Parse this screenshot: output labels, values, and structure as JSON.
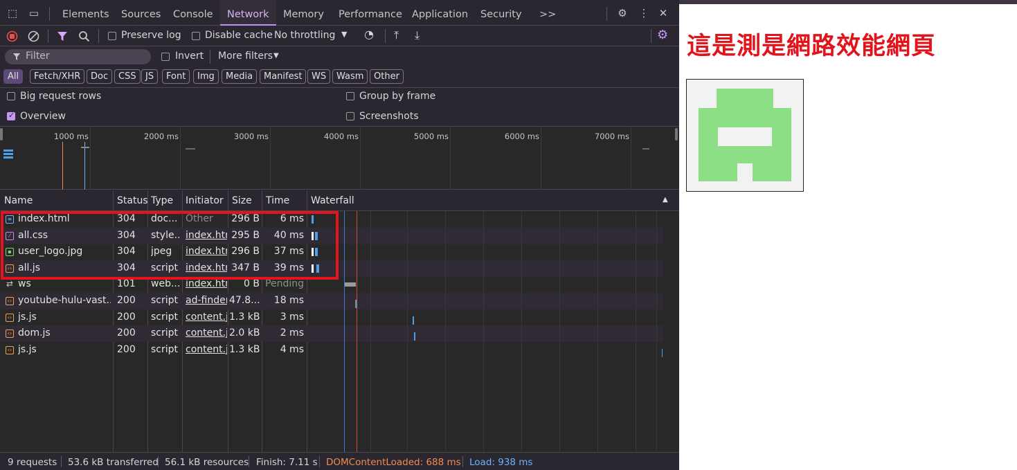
{
  "devtools": {
    "tabs": [
      "Elements",
      "Sources",
      "Console",
      "Network",
      "Memory",
      "Performance",
      "Application",
      "Security"
    ],
    "more_tabs": ">>",
    "toolbar": {
      "preserve_log": "Preserve log",
      "disable_cache": "Disable cache",
      "throttling": "No throttling"
    },
    "filter": {
      "placeholder": "Filter",
      "invert": "Invert",
      "more_filters": "More filters"
    },
    "type_chips": [
      "All",
      "Fetch/XHR",
      "Doc",
      "CSS",
      "JS",
      "Font",
      "Img",
      "Media",
      "Manifest",
      "WS",
      "Wasm",
      "Other"
    ],
    "options": {
      "big_request_rows": "Big request rows",
      "group_by_frame": "Group by frame",
      "overview": "Overview",
      "screenshots": "Screenshots"
    },
    "overview_ticks": [
      "1000 ms",
      "2000 ms",
      "3000 ms",
      "4000 ms",
      "5000 ms",
      "6000 ms",
      "7000 ms"
    ],
    "columns": [
      "Name",
      "Status",
      "Type",
      "Initiator",
      "Size",
      "Time",
      "Waterfall"
    ],
    "requests": [
      {
        "name": "index.html",
        "status": "304",
        "type": "doc...",
        "initiator": "Other",
        "size": "296 B",
        "time": "6 ms",
        "kind": "doc"
      },
      {
        "name": "all.css",
        "status": "304",
        "type": "style...",
        "initiator": "index.htm",
        "size": "295 B",
        "time": "40 ms",
        "kind": "css"
      },
      {
        "name": "user_logo.jpg",
        "status": "304",
        "type": "jpeg",
        "initiator": "index.htm",
        "size": "296 B",
        "time": "37 ms",
        "kind": "img"
      },
      {
        "name": "all.js",
        "status": "304",
        "type": "script",
        "initiator": "index.htm",
        "size": "347 B",
        "time": "39 ms",
        "kind": "js"
      },
      {
        "name": "ws",
        "status": "101",
        "type": "web...",
        "initiator": "index.htm",
        "size": "0 B",
        "time": "Pending",
        "kind": "ws"
      },
      {
        "name": "youtube-hulu-vast...",
        "status": "200",
        "type": "script",
        "initiator": "ad-finder.",
        "size": "47.8...",
        "time": "18 ms",
        "kind": "js"
      },
      {
        "name": "js.js",
        "status": "200",
        "type": "script",
        "initiator": "content.js",
        "size": "1.3 kB",
        "time": "3 ms",
        "kind": "js"
      },
      {
        "name": "dom.js",
        "status": "200",
        "type": "script",
        "initiator": "content.js",
        "size": "2.0 kB",
        "time": "2 ms",
        "kind": "js"
      },
      {
        "name": "js.js",
        "status": "200",
        "type": "script",
        "initiator": "content.js",
        "size": "1.3 kB",
        "time": "4 ms",
        "kind": "js"
      }
    ],
    "status": {
      "requests": "9 requests",
      "transferred": "53.6 kB transferred",
      "resources": "56.1 kB resources",
      "finish": "Finish: 7.11 s",
      "dom_loaded": "DOMContentLoaded: 688 ms",
      "load": "Load: 938 ms"
    },
    "colors": {
      "accent": "#c38df7",
      "dom_loaded": "#f28b54",
      "load": "#6eb3ff",
      "highlight_box": "#e3141a"
    }
  },
  "page": {
    "title": "這是測是網路效能網頁",
    "logo_alt": "user logo"
  }
}
